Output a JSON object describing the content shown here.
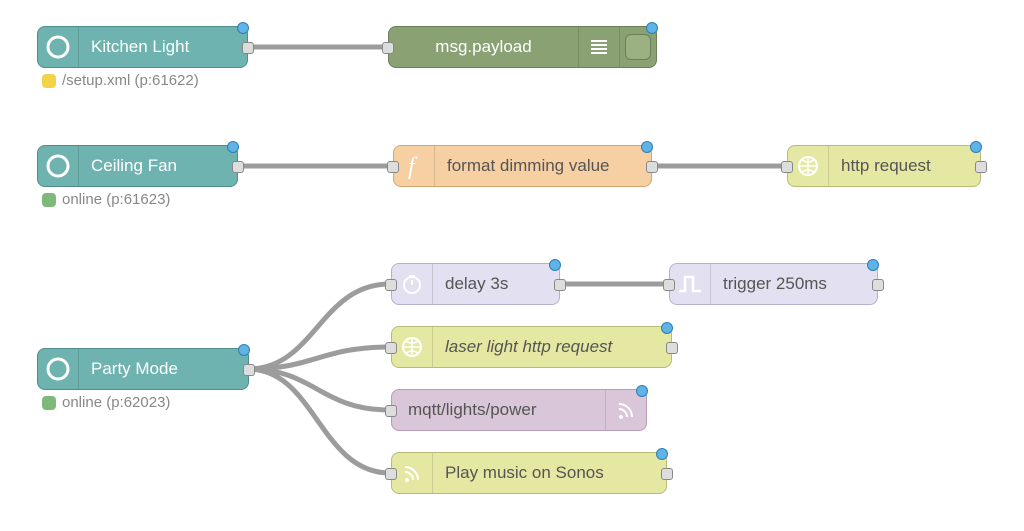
{
  "nodes": {
    "kitchen": {
      "label": "Kitchen Light"
    },
    "debug": {
      "label": "msg.payload"
    },
    "ceiling": {
      "label": "Ceiling Fan"
    },
    "format": {
      "label": "format dimming value"
    },
    "http": {
      "label": "http request"
    },
    "party": {
      "label": "Party Mode"
    },
    "delay": {
      "label": "delay 3s"
    },
    "trigger": {
      "label": "trigger 250ms"
    },
    "laser": {
      "label": "laser light http request"
    },
    "mqtt": {
      "label": "mqtt/lights/power"
    },
    "sonos": {
      "label": "Play music on Sonos"
    }
  },
  "statuses": {
    "kitchen": {
      "text": "/setup.xml (p:61622)"
    },
    "ceiling": {
      "text": "online (p:61623)"
    },
    "party": {
      "text": "online (p:62023)"
    }
  }
}
